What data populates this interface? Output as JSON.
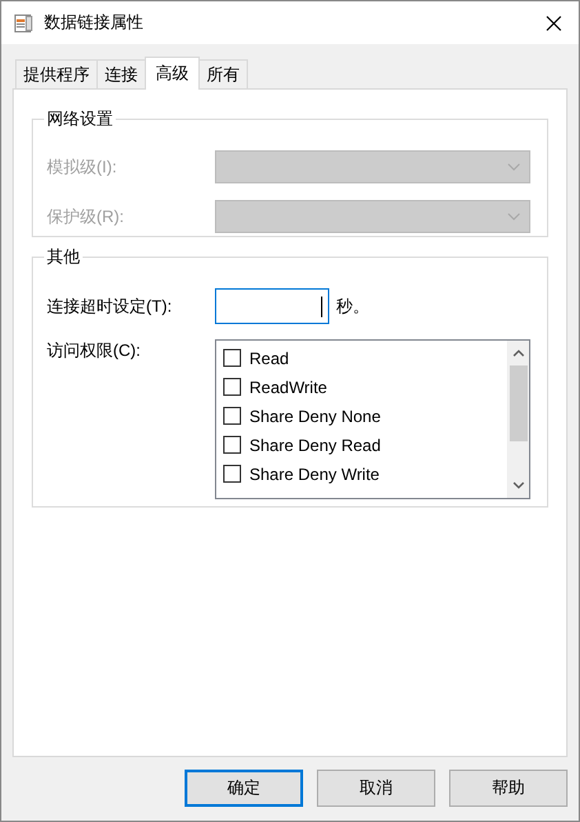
{
  "window": {
    "title": "数据链接属性"
  },
  "tabs": [
    {
      "label": "提供程序",
      "selected": false
    },
    {
      "label": "连接",
      "selected": false
    },
    {
      "label": "高级",
      "selected": true
    },
    {
      "label": "所有",
      "selected": false
    }
  ],
  "network_settings": {
    "title": "网络设置",
    "disabled": true,
    "fields": [
      {
        "label": "模拟级(I):"
      },
      {
        "label": "保护级(R):"
      }
    ]
  },
  "other": {
    "title": "其他",
    "timeout": {
      "label": "连接超时设定(T):",
      "unit": "秒。",
      "focused": true
    },
    "access": {
      "label": "访问权限(C):",
      "items": [
        {
          "label": "Read",
          "checked": false
        },
        {
          "label": "ReadWrite",
          "checked": false
        },
        {
          "label": "Share Deny None",
          "checked": false
        },
        {
          "label": "Share Deny Read",
          "checked": false
        },
        {
          "label": "Share Deny Write",
          "checked": false
        }
      ]
    }
  },
  "buttons": [
    {
      "label": "确定",
      "default": true
    },
    {
      "label": "取消",
      "default": false
    },
    {
      "label": "帮助",
      "default": false
    }
  ]
}
